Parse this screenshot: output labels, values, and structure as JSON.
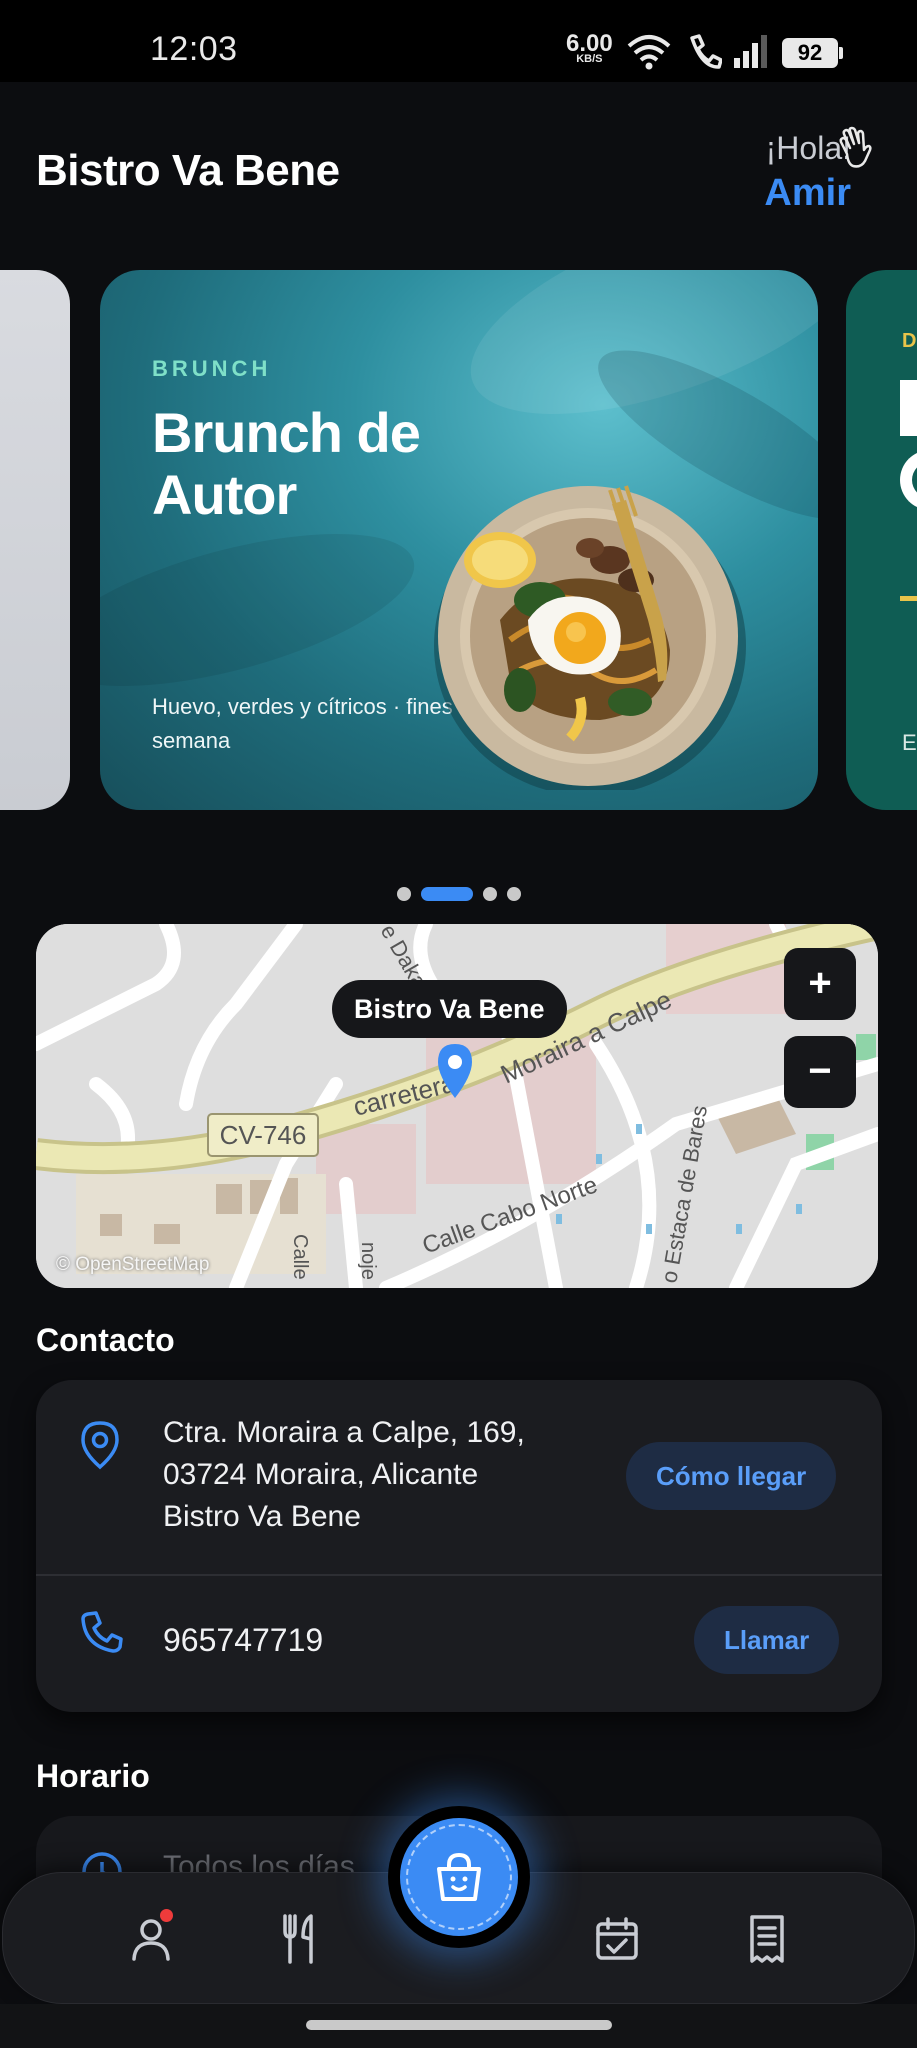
{
  "status_bar": {
    "time": "12:03",
    "net_speed": "6.00",
    "net_unit": "KB/S",
    "battery": "92",
    "icons": [
      "wifi-icon",
      "call-icon",
      "signal-icon",
      "battery-icon"
    ]
  },
  "header": {
    "title": "Bistro Va Bene",
    "greeting": "¡Hola!",
    "user_name": "Amir",
    "wave_icon": "wave-hand-icon"
  },
  "carousel": {
    "active_index": 1,
    "dot_count": 4,
    "current": {
      "tag": "BRUNCH",
      "title": "Brunch de Autor",
      "subtitle": "Huevo, verdes y cítricos · fines de semana"
    },
    "next_peek": {
      "tag": "D",
      "text": "E"
    }
  },
  "map": {
    "marker_label": "Bistro Va Bene",
    "zoom_in": "+",
    "zoom_out": "−",
    "attribution": "© OpenStreetMap",
    "road_labels": [
      "CV-746",
      "carretera",
      "Moraira a Calpe",
      "Calle Cabo Norte",
      "o Estaca de Bares",
      "e Daka",
      "Calle",
      "noje"
    ]
  },
  "contact": {
    "section_title": "Contacto",
    "address_line1": "Ctra. Moraira a Calpe, 169,",
    "address_line2": "03724 Moraira, Alicante",
    "address_line3": "Bistro Va Bene",
    "route_button": "Cómo llegar",
    "phone": "965747719",
    "call_button": "Llamar"
  },
  "hours": {
    "section_title": "Horario",
    "first_row": "Todos los días"
  },
  "bottom_nav": {
    "items": [
      "profile-icon",
      "menu-icon",
      "cart-icon",
      "calendar-icon",
      "orders-icon"
    ],
    "accent": "#3b8bf4",
    "badge_color": "#ef3b3b"
  },
  "colors": {
    "background": "#0c0d10",
    "card": "#1b1c20",
    "accent": "#3b8bf4",
    "brunch_tag": "#7fe0c8"
  }
}
